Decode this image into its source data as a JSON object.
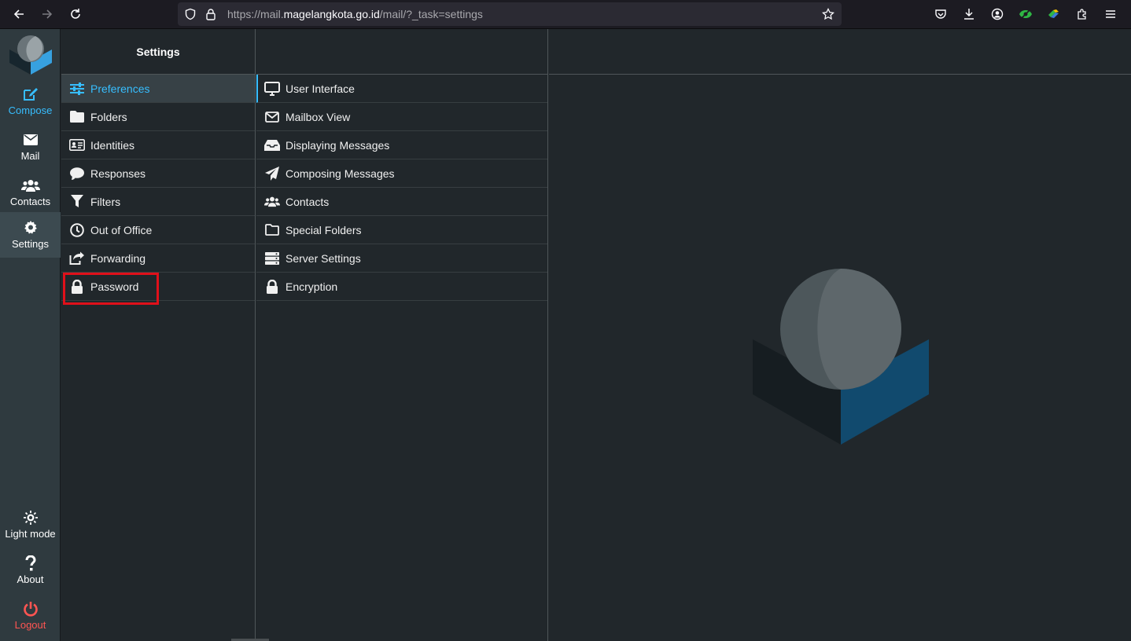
{
  "browser": {
    "url_prefix": "https://mail.",
    "url_host": "magelangkota.go.id",
    "url_path": "/mail/?_task=settings"
  },
  "taskmenu": {
    "compose": "Compose",
    "mail": "Mail",
    "contacts": "Contacts",
    "settings": "Settings",
    "light_mode": "Light mode",
    "about": "About",
    "logout": "Logout"
  },
  "settings": {
    "header": "Settings",
    "items": [
      {
        "label": "Preferences"
      },
      {
        "label": "Folders"
      },
      {
        "label": "Identities"
      },
      {
        "label": "Responses"
      },
      {
        "label": "Filters"
      },
      {
        "label": "Out of Office"
      },
      {
        "label": "Forwarding"
      },
      {
        "label": "Password"
      }
    ]
  },
  "preferences": {
    "items": [
      {
        "label": "User Interface"
      },
      {
        "label": "Mailbox View"
      },
      {
        "label": "Displaying Messages"
      },
      {
        "label": "Composing Messages"
      },
      {
        "label": "Contacts"
      },
      {
        "label": "Special Folders"
      },
      {
        "label": "Server Settings"
      },
      {
        "label": "Encryption"
      }
    ]
  },
  "colors": {
    "accent": "#37beff",
    "logout": "#ff5552",
    "highlight": "#e0101a"
  }
}
